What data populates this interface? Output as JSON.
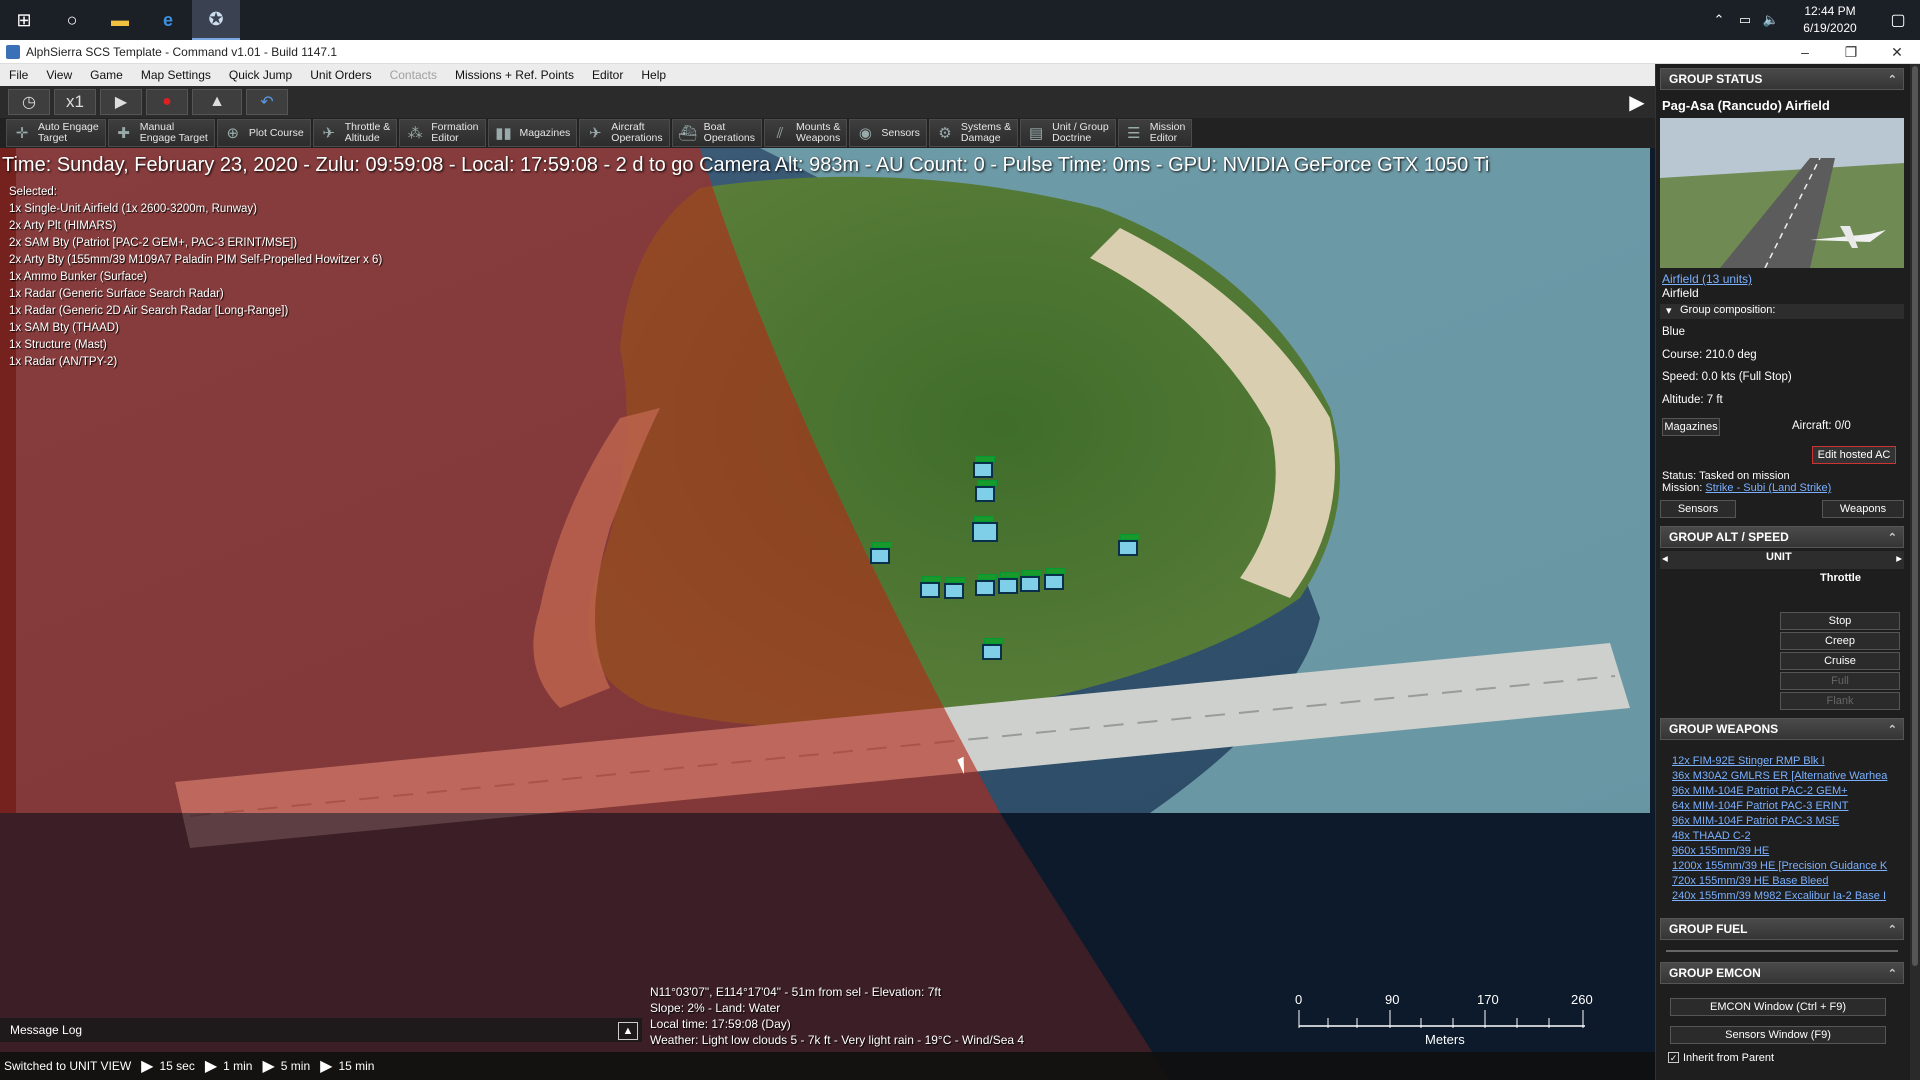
{
  "taskbar": {
    "clock_time": "12:44 PM",
    "clock_date": "6/19/2020"
  },
  "window": {
    "title": "AlphSierra SCS Template - Command v1.01 - Build 1147.1"
  },
  "menu": {
    "items": [
      "File",
      "View",
      "Game",
      "Map Settings",
      "Quick Jump",
      "Unit Orders",
      "Contacts",
      "Missions + Ref. Points",
      "Editor",
      "Help"
    ],
    "disabled_index": 6
  },
  "time_controls": {
    "speed": "x1"
  },
  "toolbar": {
    "buttons": [
      {
        "label": "Auto Engage\nTarget",
        "icon": "crosshair-icon"
      },
      {
        "label": "Manual\nEngage Target",
        "icon": "target-icon"
      },
      {
        "label": "Plot Course",
        "icon": "course-icon"
      },
      {
        "label": "Throttle &\nAltitude",
        "icon": "throttle-icon"
      },
      {
        "label": "Formation\nEditor",
        "icon": "formation-icon"
      },
      {
        "label": "Magazines",
        "icon": "magazine-icon"
      },
      {
        "label": "Aircraft\nOperations",
        "icon": "aircraft-icon"
      },
      {
        "label": "Boat\nOperations",
        "icon": "boat-icon"
      },
      {
        "label": "Mounts &\nWeapons",
        "icon": "weapons-icon"
      },
      {
        "label": "Sensors",
        "icon": "sensor-icon"
      },
      {
        "label": "Systems &\nDamage",
        "icon": "gear-icon"
      },
      {
        "label": "Unit / Group\nDoctrine",
        "icon": "doctrine-icon"
      },
      {
        "label": "Mission\nEditor",
        "icon": "mission-icon"
      }
    ]
  },
  "hud": {
    "line": "Time: Sunday, February 23, 2020 - Zulu: 09:59:08 - Local: 17:59:08 - 2 d to go   Camera Alt: 983m   - AU Count: 0 - Pulse Time: 0ms - GPU: NVIDIA GeForce GTX 1050 Ti"
  },
  "selected": {
    "header": "Selected:",
    "units": [
      "1x Single-Unit Airfield (1x 2600-3200m, Runway)",
      "2x Arty Plt (HIMARS)",
      "2x SAM Bty (Patriot [PAC-2 GEM+, PAC-3 ERINT/MSE])",
      "2x Arty Bty (155mm/39 M109A7 Paladin PIM Self-Propelled Howitzer x 6)",
      "1x Ammo Bunker (Surface)",
      "1x Radar (Generic Surface Search Radar)",
      "1x Radar (Generic 2D Air Search Radar [Long-Range])",
      "1x SAM Bty (THAAD)",
      "1x Structure (Mast)",
      "1x Radar (AN/TPY-2)"
    ]
  },
  "cursor_info": {
    "lines": [
      "N11°03'07\", E114°17'04\" - 51m from sel - Elevation: 7ft",
      "Slope: 2%  - Land: Water",
      "Local time: 17:59:08 (Day)",
      "Weather: Light low clouds 5 - 7k ft - Very light rain - 19°C - Wind/Sea 4"
    ]
  },
  "scale": {
    "labels": [
      "0",
      "90",
      "170",
      "260"
    ],
    "unit": "Meters"
  },
  "message_log": {
    "label": "Message Log"
  },
  "status_bar": {
    "text": "Switched to UNIT VIEW",
    "steps": [
      "15 sec",
      "1 min",
      "5 min",
      "15 min"
    ]
  },
  "panel": {
    "group_status": {
      "header": "GROUP STATUS",
      "name": "Pag-Asa (Rancudo) Airfield",
      "link": "Airfield (13 units)",
      "type": "Airfield",
      "composition": "Group composition:",
      "side": "Blue",
      "course": "Course: 210.0 deg",
      "speed": "Speed: 0.0 kts (Full Stop)",
      "altitude": "Altitude: 7 ft",
      "magazines_btn": "Magazines",
      "aircraft": "Aircraft: 0/0",
      "edit_hosted_btn": "Edit hosted AC",
      "status": "Status: Tasked on mission",
      "mission_label": "Mission: ",
      "mission_link": "Strike - Subi (Land Strike)",
      "sensors_btn": "Sensors",
      "weapons_btn": "Weapons"
    },
    "group_alt_speed": {
      "header": "GROUP ALT / SPEED",
      "unit_label": "UNIT",
      "throttle_label": "Throttle",
      "buttons": [
        "Stop",
        "Creep",
        "Cruise",
        "Full",
        "Flank"
      ]
    },
    "group_weapons": {
      "header": "GROUP WEAPONS",
      "items": [
        "12x FIM-92E Stinger RMP Blk I",
        "36x M30A2 GMLRS ER [Alternative Warhea",
        "96x MIM-104E Patriot PAC-2 GEM+",
        "64x MIM-104F Patriot PAC-3 ERINT",
        "96x MIM-104F Patriot PAC-3 MSE",
        "48x THAAD C-2",
        "960x 155mm/39 HE",
        "1200x 155mm/39 HE [Precision Guidance K",
        "720x 155mm/39 HE Base Bleed",
        "240x 155mm/39 M982 Excalibur Ia-2 Base I"
      ]
    },
    "group_fuel": {
      "header": "GROUP FUEL"
    },
    "group_emcon": {
      "header": "GROUP EMCON",
      "emcon_btn": "EMCON Window (Ctrl + F9)",
      "sensors_btn": "Sensors Window (F9)",
      "inherit_label": "Inherit from Parent"
    }
  }
}
